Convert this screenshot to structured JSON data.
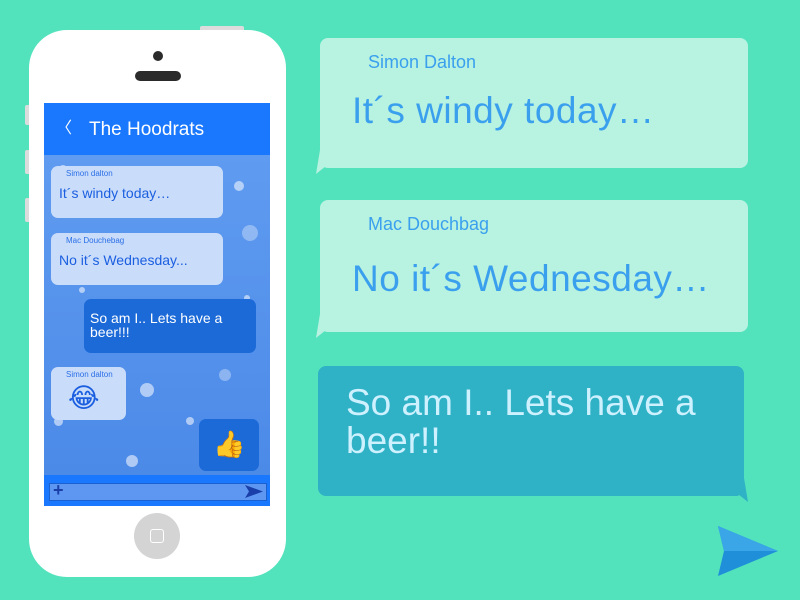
{
  "phone": {
    "chat_title": "The Hoodrats",
    "back_icon": "chevron-left-icon",
    "messages": [
      {
        "sender": "Simon dalton",
        "text": "It´s windy today…",
        "direction": "in"
      },
      {
        "sender": "Mac Douchebag",
        "text": "No it´s Wednesday...",
        "direction": "in"
      },
      {
        "text": "So am I.. Lets have a beer!!!",
        "direction": "out"
      },
      {
        "sender": "Simon dalton",
        "emoji": "😂",
        "icon": "tears-of-joy-emoji",
        "direction": "in"
      },
      {
        "emoji": "👍",
        "icon": "thumbs-up-emoji",
        "direction": "out"
      }
    ],
    "input": {
      "plus_icon": "+",
      "send_icon": "send-icon"
    }
  },
  "conversation": [
    {
      "sender": "Simon Dalton",
      "text": "It´s windy today…",
      "direction": "in"
    },
    {
      "sender": "Mac Douchbag",
      "text": "No it´s Wednesday…",
      "direction": "in"
    },
    {
      "text": "So am I.. Lets have a beer!!",
      "direction": "out"
    }
  ],
  "colors": {
    "background": "#52e3bd",
    "incoming_bubble": "#b8f2e0",
    "outgoing_bubble": "#2fb1c6",
    "text_blue": "#3aa0ee",
    "header_blue": "#1a78ff"
  }
}
